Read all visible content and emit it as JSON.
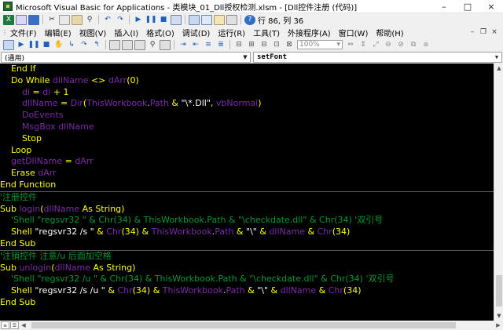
{
  "window": {
    "title": "Microsoft Visual Basic for Applications - 类模块_01_Dll授权检测.xlsm - [Dll控件注册 (代码)]",
    "controls": [
      "–",
      "□",
      "×"
    ]
  },
  "toolbar": {
    "position_readout": "行 86, 列 36",
    "zoom_value": "100%"
  },
  "menu": {
    "items": [
      "文件(F)",
      "编辑(E)",
      "视图(V)",
      "插入(I)",
      "格式(O)",
      "调试(D)",
      "运行(R)",
      "工具(T)",
      "外接程序(A)",
      "窗口(W)",
      "帮助(H)"
    ],
    "mdi_controls": [
      "–",
      "❐",
      "×"
    ]
  },
  "code_window": {
    "object_combo": "(通用)",
    "procedure_combo": "setFont"
  },
  "colors": {
    "keyword": "#ffff00",
    "identifier": "#7a2ba5",
    "comment": "#009933",
    "string": "#ffffff",
    "background": "#000000"
  },
  "code": [
    {
      "indent": "    ",
      "parts": [
        {
          "t": "k",
          "v": "End If"
        }
      ]
    },
    {
      "indent": "    ",
      "parts": [
        {
          "t": "k",
          "v": "Do While "
        },
        {
          "t": "t",
          "v": "dllName"
        },
        {
          "t": "k",
          "v": " <> "
        },
        {
          "t": "t",
          "v": "dArr"
        },
        {
          "t": "k",
          "v": "(0)"
        }
      ]
    },
    {
      "indent": "        ",
      "parts": [
        {
          "t": "t",
          "v": "di"
        },
        {
          "t": "k",
          "v": " = "
        },
        {
          "t": "t",
          "v": "di"
        },
        {
          "t": "k",
          "v": " + 1"
        }
      ]
    },
    {
      "indent": "        ",
      "parts": [
        {
          "t": "t",
          "v": "dllName"
        },
        {
          "t": "k",
          "v": " = "
        },
        {
          "t": "t",
          "v": "Dir"
        },
        {
          "t": "k",
          "v": "("
        },
        {
          "t": "t",
          "v": "ThisWorkbook"
        },
        {
          "t": "k",
          "v": "."
        },
        {
          "t": "t",
          "v": "Path"
        },
        {
          "t": "k",
          "v": " & "
        },
        {
          "t": "s",
          "v": "\"\\*.Dll\""
        },
        {
          "t": "k",
          "v": ", "
        },
        {
          "t": "t",
          "v": "vbNormal"
        },
        {
          "t": "k",
          "v": ")"
        }
      ]
    },
    {
      "indent": "        ",
      "parts": [
        {
          "t": "t",
          "v": "DoEvents"
        }
      ]
    },
    {
      "indent": "        ",
      "parts": [
        {
          "t": "t",
          "v": "MsgBox"
        },
        {
          "t": "k",
          "v": " "
        },
        {
          "t": "t",
          "v": "dllName"
        }
      ]
    },
    {
      "indent": "        ",
      "parts": [
        {
          "t": "k",
          "v": "Stop"
        }
      ]
    },
    {
      "indent": "    ",
      "parts": [
        {
          "t": "k",
          "v": "Loop"
        }
      ]
    },
    {
      "indent": "    ",
      "parts": [
        {
          "t": "t",
          "v": "getDllName"
        },
        {
          "t": "k",
          "v": " = "
        },
        {
          "t": "t",
          "v": "dArr"
        }
      ]
    },
    {
      "indent": "    ",
      "parts": [
        {
          "t": "k",
          "v": "Erase "
        },
        {
          "t": "t",
          "v": "dArr"
        }
      ]
    },
    {
      "indent": "",
      "parts": [
        {
          "t": "k",
          "v": "End Function"
        }
      ],
      "divider_after": true
    },
    {
      "indent": "",
      "parts": [
        {
          "t": "c",
          "v": "'注册控件"
        }
      ]
    },
    {
      "indent": "",
      "parts": [
        {
          "t": "k",
          "v": "Sub "
        },
        {
          "t": "t",
          "v": "login"
        },
        {
          "t": "k",
          "v": "("
        },
        {
          "t": "t",
          "v": "dllName"
        },
        {
          "t": "k",
          "v": " As String)"
        }
      ]
    },
    {
      "indent": "    ",
      "parts": [
        {
          "t": "c",
          "v": "'Shell \"regsvr32 \" & Chr(34) & ThisWorkbook.Path & \"\\checkdate.dll\" & Chr(34) '双引号"
        }
      ]
    },
    {
      "indent": "    ",
      "parts": [
        {
          "t": "k",
          "v": "Shell "
        },
        {
          "t": "s",
          "v": "\"regsvr32 /s \""
        },
        {
          "t": "k",
          "v": " & "
        },
        {
          "t": "t",
          "v": "Chr"
        },
        {
          "t": "k",
          "v": "(34) & "
        },
        {
          "t": "t",
          "v": "ThisWorkbook"
        },
        {
          "t": "k",
          "v": "."
        },
        {
          "t": "t",
          "v": "Path"
        },
        {
          "t": "k",
          "v": " & "
        },
        {
          "t": "s",
          "v": "\"\\\""
        },
        {
          "t": "k",
          "v": " & "
        },
        {
          "t": "t",
          "v": "dllName"
        },
        {
          "t": "k",
          "v": " & "
        },
        {
          "t": "t",
          "v": "Chr"
        },
        {
          "t": "k",
          "v": "(34)"
        }
      ]
    },
    {
      "indent": "",
      "parts": [
        {
          "t": "k",
          "v": "End Sub"
        }
      ],
      "divider_after": true
    },
    {
      "indent": "",
      "parts": [
        {
          "t": "c",
          "v": "'注销控件 注意/u 后面加空格"
        }
      ]
    },
    {
      "indent": "",
      "parts": [
        {
          "t": "k",
          "v": "Sub "
        },
        {
          "t": "t",
          "v": "unlogin"
        },
        {
          "t": "k",
          "v": "("
        },
        {
          "t": "t",
          "v": "dllName"
        },
        {
          "t": "k",
          "v": " As String)"
        }
      ]
    },
    {
      "indent": "    ",
      "parts": [
        {
          "t": "c",
          "v": "'Shell \"regsvr32 /u \" & Chr(34) & ThisWorkbook.Path & \"\\checkdate.dll\" & Chr(34) '双引号"
        }
      ]
    },
    {
      "indent": "    ",
      "parts": [
        {
          "t": "k",
          "v": "Shell "
        },
        {
          "t": "s",
          "v": "\"regsvr32 /s /u \""
        },
        {
          "t": "k",
          "v": " & "
        },
        {
          "t": "t",
          "v": "Chr"
        },
        {
          "t": "k",
          "v": "(34) & "
        },
        {
          "t": "t",
          "v": "ThisWorkbook"
        },
        {
          "t": "k",
          "v": "."
        },
        {
          "t": "t",
          "v": "Path"
        },
        {
          "t": "k",
          "v": " & "
        },
        {
          "t": "s",
          "v": "\"\\\""
        },
        {
          "t": "k",
          "v": " & "
        },
        {
          "t": "t",
          "v": "dllName"
        },
        {
          "t": "k",
          "v": " & "
        },
        {
          "t": "t",
          "v": "Chr"
        },
        {
          "t": "k",
          "v": "(34)"
        }
      ]
    },
    {
      "indent": "",
      "parts": [
        {
          "t": "k",
          "v": "End Sub"
        }
      ]
    }
  ]
}
